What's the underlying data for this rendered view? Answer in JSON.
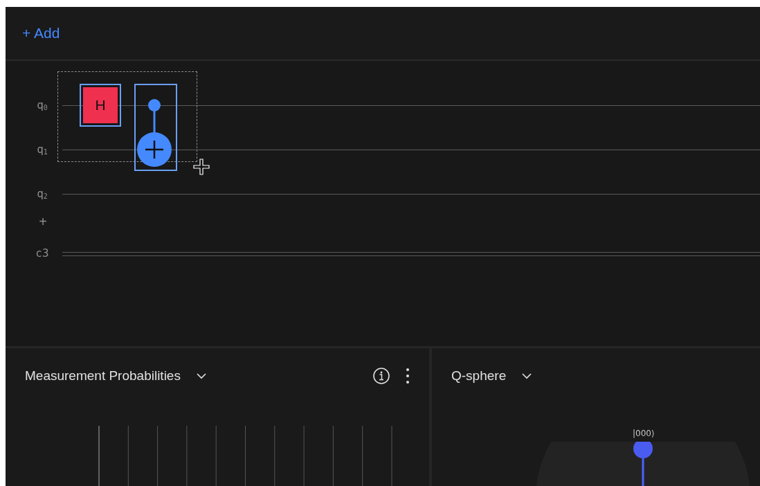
{
  "toolbar": {
    "add_label": "+ Add"
  },
  "circuit": {
    "wires": [
      {
        "kind": "quantum",
        "label": "q$_{0}$"
      },
      {
        "kind": "quantum",
        "label": "q$_{1}$"
      },
      {
        "kind": "quantum",
        "label": "q$_{2}$"
      },
      {
        "kind": "add",
        "label": "+"
      },
      {
        "kind": "classical",
        "label": "c3"
      }
    ],
    "gates": [
      {
        "kind": "h",
        "label": "H",
        "selected": true
      },
      {
        "kind": "cnot",
        "selected": true
      }
    ]
  },
  "panels": [
    {
      "kind": "probabilities",
      "title": "Measurement Probabilities",
      "info": true,
      "menu": true
    },
    {
      "kind": "qsphere",
      "title": "Q-sphere",
      "state_label": "|000⟩"
    }
  ]
}
